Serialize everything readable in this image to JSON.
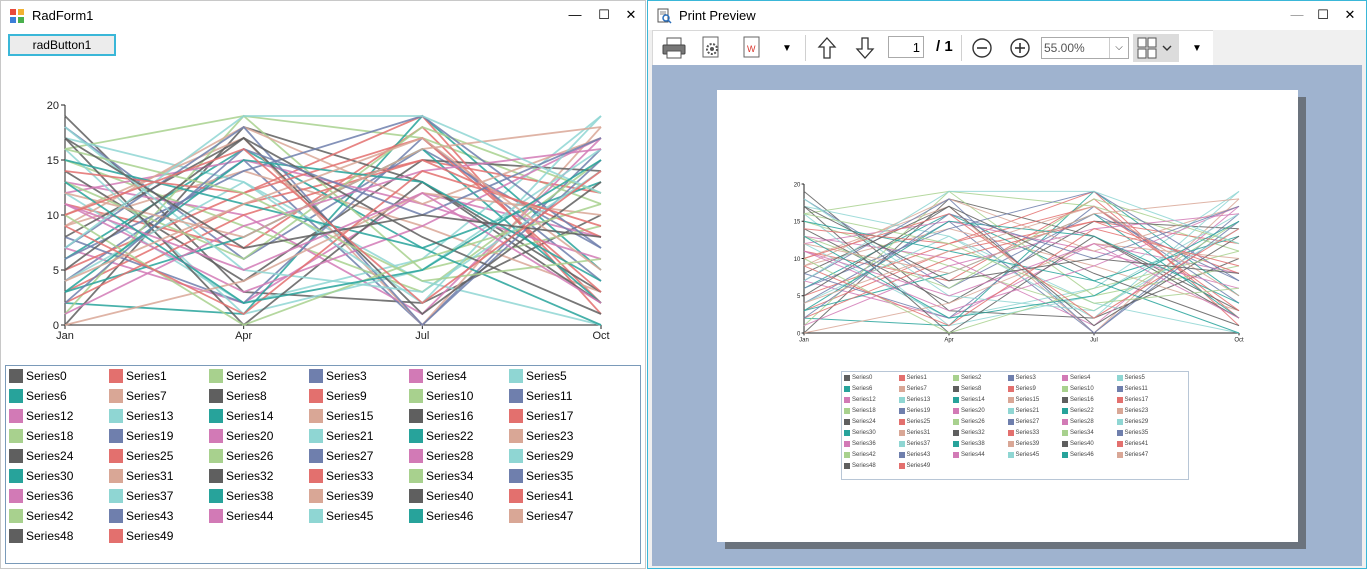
{
  "window_left": {
    "title": "RadForm1",
    "button_label": "radButton1",
    "minimize": "—",
    "maximize": "☐",
    "close": "✕"
  },
  "window_right": {
    "title": "Print Preview",
    "minimize": "—",
    "maximize": "☐",
    "close": "✕",
    "toolbar": {
      "current_page": "1",
      "page_total": "/ 1",
      "zoom": "55.00%"
    }
  },
  "colors": {
    "palette": [
      "#5f5f5f",
      "#e3706e",
      "#a8d18e",
      "#6f7fad",
      "#d27ab6",
      "#8fd6d3",
      "#27a39b",
      "#d9a796"
    ]
  },
  "chart_data": {
    "type": "line",
    "categories": [
      "Jan",
      "Apr",
      "Jul",
      "Oct"
    ],
    "ylim": [
      0,
      20
    ],
    "yticks": [
      "0",
      "5",
      "10",
      "15",
      "20"
    ],
    "legend_placement": "bottom",
    "series": [
      {
        "name": "Series0",
        "values": [
          19,
          3,
          2,
          10
        ]
      },
      {
        "name": "Series1",
        "values": [
          11,
          7,
          18,
          2
        ]
      },
      {
        "name": "Series2",
        "values": [
          16,
          19,
          17,
          11
        ]
      },
      {
        "name": "Series3",
        "values": [
          4,
          15,
          0,
          16
        ]
      },
      {
        "name": "Series4",
        "values": [
          7,
          2,
          12,
          8
        ]
      },
      {
        "name": "Series5",
        "values": [
          12,
          2,
          6,
          19
        ]
      },
      {
        "name": "Series6",
        "values": [
          2,
          1,
          19,
          5
        ]
      },
      {
        "name": "Series7",
        "values": [
          9,
          14,
          9,
          3
        ]
      },
      {
        "name": "Series8",
        "values": [
          0,
          18,
          13,
          3
        ]
      },
      {
        "name": "Series9",
        "values": [
          3,
          11,
          15,
          12
        ]
      },
      {
        "name": "Series10",
        "values": [
          15,
          9,
          3,
          15
        ]
      },
      {
        "name": "Series11",
        "values": [
          18,
          6,
          16,
          7
        ]
      },
      {
        "name": "Series12",
        "values": [
          13,
          10,
          1,
          17
        ]
      },
      {
        "name": "Series13",
        "values": [
          17,
          13,
          4,
          0
        ]
      },
      {
        "name": "Series14",
        "values": [
          6,
          16,
          7,
          13
        ]
      },
      {
        "name": "Series15",
        "values": [
          10,
          17,
          0,
          18
        ]
      },
      {
        "name": "Series16",
        "values": [
          14,
          4,
          15,
          14
        ]
      },
      {
        "name": "Series17",
        "values": [
          5,
          12,
          19,
          1
        ]
      },
      {
        "name": "Series18",
        "values": [
          1,
          19,
          5,
          9
        ]
      },
      {
        "name": "Series19",
        "values": [
          8,
          2,
          17,
          4
        ]
      },
      {
        "name": "Series20",
        "values": [
          12,
          15,
          11,
          6
        ]
      },
      {
        "name": "Series21",
        "values": [
          16,
          1,
          5,
          16
        ]
      },
      {
        "name": "Series22",
        "values": [
          3,
          8,
          16,
          2
        ]
      },
      {
        "name": "Series23",
        "values": [
          9,
          18,
          11,
          17
        ]
      },
      {
        "name": "Series24",
        "values": [
          17,
          0,
          13,
          2
        ]
      },
      {
        "name": "Series25",
        "values": [
          2,
          10,
          15,
          8
        ]
      },
      {
        "name": "Series26",
        "values": [
          13,
          6,
          18,
          12
        ]
      },
      {
        "name": "Series27",
        "values": [
          7,
          18,
          0,
          15
        ]
      },
      {
        "name": "Series28",
        "values": [
          11,
          3,
          9,
          17
        ]
      },
      {
        "name": "Series29",
        "values": [
          4,
          13,
          2,
          19
        ]
      },
      {
        "name": "Series30",
        "values": [
          15,
          11,
          7,
          0
        ]
      },
      {
        "name": "Series31",
        "values": [
          0,
          4,
          12,
          10
        ]
      },
      {
        "name": "Series32",
        "values": [
          8,
          17,
          1,
          13
        ]
      },
      {
        "name": "Series33",
        "values": [
          14,
          12,
          17,
          3
        ]
      },
      {
        "name": "Series34",
        "values": [
          10,
          0,
          6,
          11
        ]
      },
      {
        "name": "Series35",
        "values": [
          6,
          14,
          19,
          7
        ]
      },
      {
        "name": "Series36",
        "values": [
          1,
          9,
          14,
          16
        ]
      },
      {
        "name": "Series37",
        "values": [
          18,
          5,
          3,
          14
        ]
      },
      {
        "name": "Series38",
        "values": [
          3,
          15,
          13,
          4
        ]
      },
      {
        "name": "Series39",
        "values": [
          12,
          8,
          16,
          18
        ]
      },
      {
        "name": "Series40",
        "values": [
          5,
          17,
          8,
          1
        ]
      },
      {
        "name": "Series41",
        "values": [
          9,
          1,
          14,
          9
        ]
      },
      {
        "name": "Series42",
        "values": [
          16,
          12,
          4,
          6
        ]
      },
      {
        "name": "Series43",
        "values": [
          2,
          16,
          10,
          17
        ]
      },
      {
        "name": "Series44",
        "values": [
          11,
          5,
          12,
          2
        ]
      },
      {
        "name": "Series45",
        "values": [
          7,
          19,
          19,
          12
        ]
      },
      {
        "name": "Series46",
        "values": [
          13,
          2,
          5,
          15
        ]
      },
      {
        "name": "Series47",
        "values": [
          4,
          11,
          17,
          5
        ]
      },
      {
        "name": "Series48",
        "values": [
          17,
          7,
          10,
          8
        ]
      },
      {
        "name": "Series49",
        "values": [
          10,
          16,
          2,
          14
        ]
      }
    ]
  }
}
